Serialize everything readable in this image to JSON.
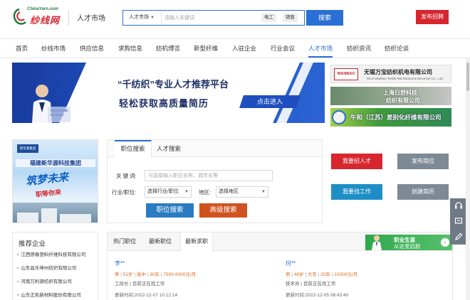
{
  "header": {
    "site_url": "ChinaYarn.com",
    "brand": "纱线网",
    "section": "人才市场",
    "search": {
      "category": "人才市场",
      "placeholder": "请输入关键词",
      "tags": [
        "电工",
        "销售"
      ],
      "button": "搜索"
    },
    "post_button": "发布招聘"
  },
  "nav": {
    "items": [
      {
        "label": "首页"
      },
      {
        "label": "纱线市场"
      },
      {
        "label": "供应信息"
      },
      {
        "label": "求购信息"
      },
      {
        "label": "纺机博览"
      },
      {
        "label": "新型纤维"
      },
      {
        "label": "入驻企业"
      },
      {
        "label": "行业会议"
      },
      {
        "label": "人才市场"
      },
      {
        "label": "纺织资讯"
      },
      {
        "label": "纺织论谈"
      }
    ],
    "active": "人才市场"
  },
  "banner": {
    "title_line1": "“千纺织”专业人才推荐平台",
    "title_line2": "轻松获取高质量简历",
    "cta": "点击进入"
  },
  "ads": {
    "ad1_logo": "WANBAO",
    "ad1_name": "无锡万宝纺织机电有限公司",
    "ad1_sub": "Wuxi Wanbao Textile Mechanical & Electrical Co., Ltd.",
    "ad2_line1": "上海日舒科技",
    "ad2_line2": "纺织有限公司",
    "ad3_name": "午和（江苏）差别化纤维有限公司"
  },
  "company_ad": {
    "logo": "新华源集团",
    "name": "福建新华源科技集团",
    "slogan1": "筑梦未来",
    "slogan2": "职等你来"
  },
  "recommended": {
    "title": "推荐企业",
    "items": [
      "江西德春塑料纤维科技有限公司",
      "山东昌乐坤州纺织有限公司",
      "河南万利源纺织有限公司",
      "山东正凯新材料股份有限公司"
    ]
  },
  "job_search": {
    "tabs": [
      "职位搜索",
      "人才搜索"
    ],
    "keyword_label": "关 键 词:",
    "keyword_placeholder": "可直接输入职位名称、城市名等",
    "industry_label": "行业/职位:",
    "industry_select": "选择行业/职位",
    "region_label": "地区:",
    "region_select": "选择地区",
    "search_button": "职位搜索",
    "advanced_button": "高级搜索"
  },
  "actions": {
    "recruit": "我要招人才",
    "post_job": "发布岗位",
    "find_job": "我要找工作",
    "create_resume": "创建简历"
  },
  "listing": {
    "tabs": [
      "热门职位",
      "最新职位",
      "最新求职"
    ],
    "active_tab": "最新求职",
    "career_ad_line1": "职业生涯",
    "career_ad_line2": "从这里启航",
    "entries": [
      {
        "name": "李**",
        "gender": "男",
        "age": "51岁",
        "education": "高中",
        "experience": "30年",
        "salary": "7500-8000元/月",
        "position": "工段长",
        "status": "目前正在找工作",
        "updated": "更新时间:2022-12-07 10:12:14"
      },
      {
        "name": "何**",
        "gender": "男",
        "age": "48岁",
        "education": "大专",
        "experience": "20年",
        "salary": "10000元/月",
        "position": "技术员",
        "status": "目前正在找工作",
        "updated": "更新时间:2022-12-05 08:43:40"
      }
    ]
  },
  "colors": {
    "primary_blue": "#2a6fd6",
    "brand_red": "#d7262e",
    "teal_button": "#1e8fc6",
    "gray_button": "#7d8a95",
    "orange_button": "#d0531f"
  }
}
